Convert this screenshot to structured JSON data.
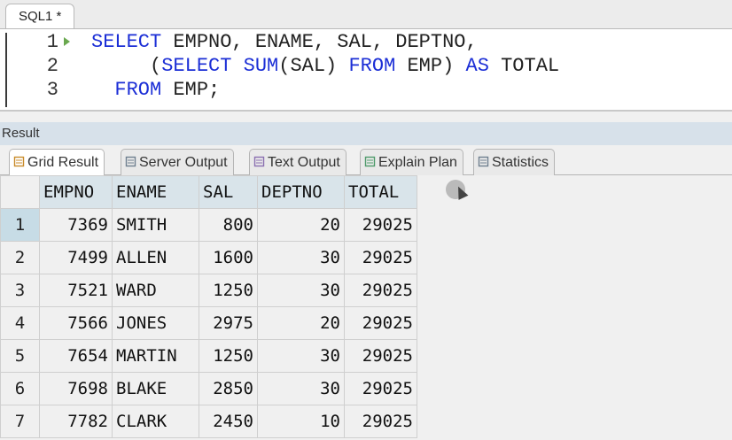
{
  "editor": {
    "tab_label": "SQL1 *",
    "lines": [
      {
        "num": "1",
        "tokens": [
          [
            "kw",
            "SELECT"
          ],
          [
            "id",
            " EMPNO, ENAME, SAL, DEPTNO,"
          ]
        ]
      },
      {
        "num": "2",
        "tokens": [
          [
            "id",
            "     ("
          ],
          [
            "kw",
            "SELECT"
          ],
          [
            "id",
            " "
          ],
          [
            "kw",
            "SUM"
          ],
          [
            "id",
            "(SAL) "
          ],
          [
            "kw",
            "FROM"
          ],
          [
            "id",
            " EMP) "
          ],
          [
            "kw",
            "AS"
          ],
          [
            "id",
            " TOTAL"
          ]
        ]
      },
      {
        "num": "3",
        "tokens": [
          [
            "id",
            "  "
          ],
          [
            "kw",
            "FROM"
          ],
          [
            "id",
            " EMP;"
          ]
        ]
      }
    ]
  },
  "result": {
    "header": "Result",
    "tabs": [
      {
        "label": "Grid Result",
        "icon": "grid-icon",
        "active": true
      },
      {
        "label": "Server Output",
        "icon": "server-output-icon",
        "active": false
      },
      {
        "label": "Text Output",
        "icon": "text-output-icon",
        "active": false
      },
      {
        "label": "Explain Plan",
        "icon": "explain-plan-icon",
        "active": false
      },
      {
        "label": "Statistics",
        "icon": "statistics-icon",
        "active": false
      }
    ],
    "columns": [
      "EMPNO",
      "ENAME",
      "SAL",
      "DEPTNO",
      "TOTAL"
    ],
    "rows": [
      [
        "1",
        "7369",
        "SMITH",
        "800",
        "20",
        "29025"
      ],
      [
        "2",
        "7499",
        "ALLEN",
        "1600",
        "30",
        "29025"
      ],
      [
        "3",
        "7521",
        "WARD",
        "1250",
        "30",
        "29025"
      ],
      [
        "4",
        "7566",
        "JONES",
        "2975",
        "20",
        "29025"
      ],
      [
        "5",
        "7654",
        "MARTIN",
        "1250",
        "30",
        "29025"
      ],
      [
        "6",
        "7698",
        "BLAKE",
        "2850",
        "30",
        "29025"
      ],
      [
        "7",
        "7782",
        "CLARK",
        "2450",
        "10",
        "29025"
      ]
    ],
    "selected_row": "1"
  },
  "colors": {
    "keyword": "#1c2fd6",
    "header_bg": "#d9e4ea",
    "selected_row": "#c7dce6"
  }
}
